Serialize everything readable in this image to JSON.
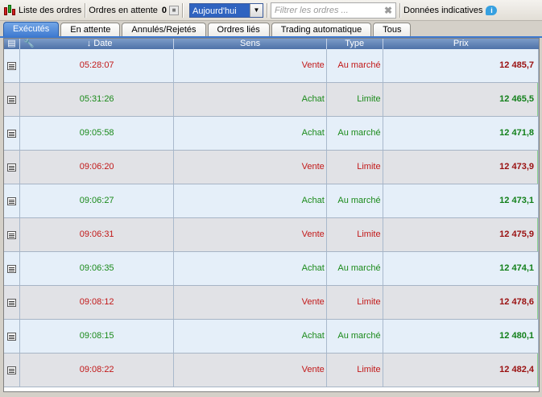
{
  "toolbar": {
    "title": "Liste des ordres",
    "pending_label": "Ordres en attente",
    "pending_count": "0",
    "period": "Aujourd'hui",
    "filter_placeholder": "Filtrer les ordres ...",
    "indicative_label": "Données indicatives"
  },
  "tabs": [
    {
      "label": "Exécutés",
      "active": true
    },
    {
      "label": "En attente"
    },
    {
      "label": "Annulés/Rejetés"
    },
    {
      "label": "Ordres liés"
    },
    {
      "label": "Trading automatique"
    },
    {
      "label": "Tous"
    }
  ],
  "columns": {
    "date": "Date",
    "sens": "Sens",
    "type": "Type",
    "prix": "Prix"
  },
  "colors": {
    "sell": "#c21818",
    "buy": "#1a8a1a",
    "active_tab": "#3d79d0"
  },
  "rows": [
    {
      "date": "05:28:07",
      "sens": "Vente",
      "type": "Au marché",
      "prix": "12 485,7"
    },
    {
      "date": "05:31:26",
      "sens": "Achat",
      "type": "Limite",
      "prix": "12 465,5"
    },
    {
      "date": "09:05:58",
      "sens": "Achat",
      "type": "Au marché",
      "prix": "12 471,8"
    },
    {
      "date": "09:06:20",
      "sens": "Vente",
      "type": "Limite",
      "prix": "12 473,9"
    },
    {
      "date": "09:06:27",
      "sens": "Achat",
      "type": "Au marché",
      "prix": "12 473,1"
    },
    {
      "date": "09:06:31",
      "sens": "Vente",
      "type": "Limite",
      "prix": "12 475,9"
    },
    {
      "date": "09:06:35",
      "sens": "Achat",
      "type": "Au marché",
      "prix": "12 474,1"
    },
    {
      "date": "09:08:12",
      "sens": "Vente",
      "type": "Limite",
      "prix": "12 478,6"
    },
    {
      "date": "09:08:15",
      "sens": "Achat",
      "type": "Au marché",
      "prix": "12 480,1"
    },
    {
      "date": "09:08:22",
      "sens": "Vente",
      "type": "Limite",
      "prix": "12 482,4"
    }
  ]
}
